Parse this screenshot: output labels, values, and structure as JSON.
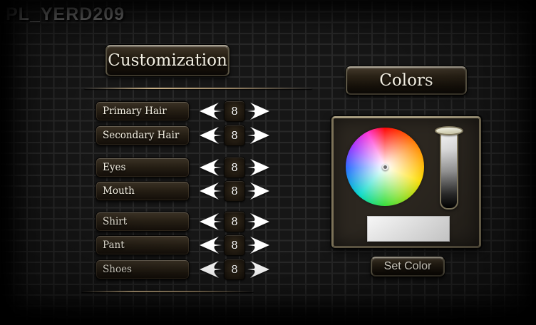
{
  "watermark": "PL_YERD209",
  "customization": {
    "title": "Customization",
    "rows": [
      {
        "label": "Primary Hair",
        "value": "8"
      },
      {
        "label": "Secondary Hair",
        "value": "8"
      },
      {
        "label": "Eyes",
        "value": "8"
      },
      {
        "label": "Mouth",
        "value": "8"
      },
      {
        "label": "Shirt",
        "value": "8"
      },
      {
        "label": "Pant",
        "value": "8"
      },
      {
        "label": "Shoes",
        "value": "8"
      }
    ]
  },
  "colors_panel": {
    "title": "Colors",
    "set_color_button": "Set Color",
    "selected_color": "#f4f4f4",
    "wheel_hues_clockwise_from_top": [
      "red",
      "orange",
      "yellow",
      "green",
      "cyan",
      "blue",
      "purple",
      "magenta"
    ],
    "value_bar": {
      "top": "#ffffff",
      "bottom": "#000000"
    }
  },
  "icons": {
    "decrement": "left-arrow",
    "increment": "right-arrow"
  },
  "theme": {
    "accent_frame": "#a89d80",
    "divider": "#cbb286",
    "plate_text": "#f3efe2",
    "background": "#161616"
  }
}
